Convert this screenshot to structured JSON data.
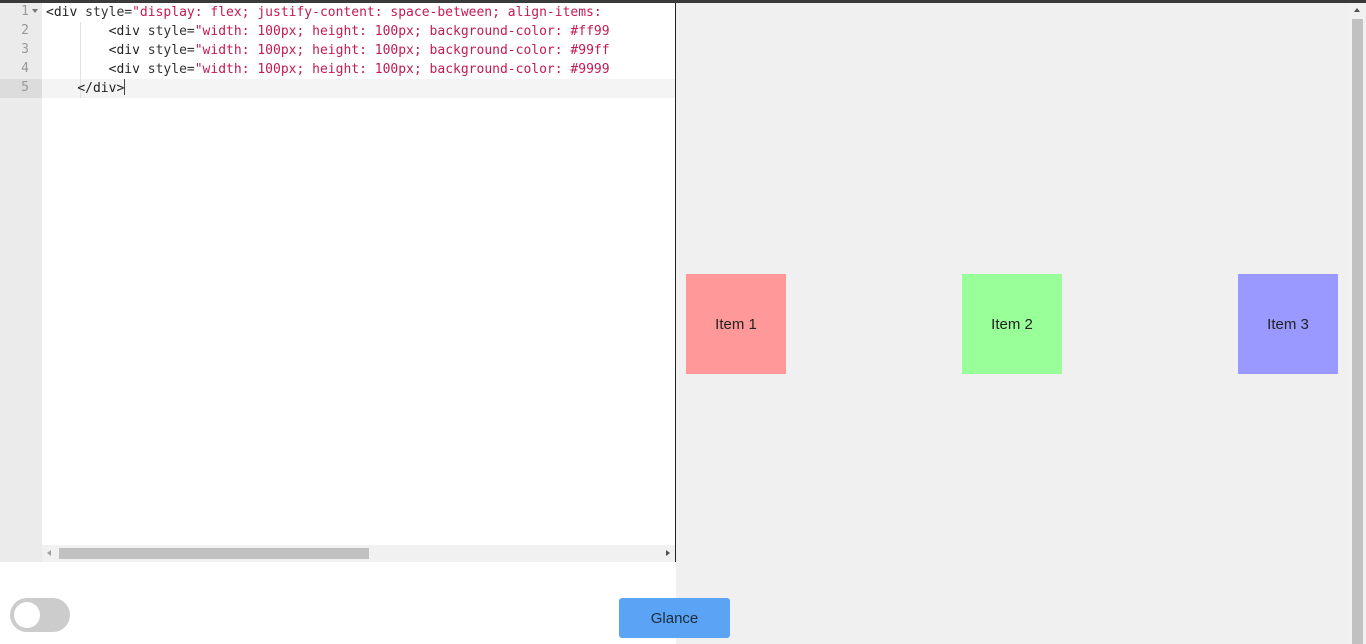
{
  "editor": {
    "line_numbers": [
      "1",
      "2",
      "3",
      "4",
      "5"
    ],
    "lines": [
      {
        "indent": "",
        "tag": "<div ",
        "attr": "style=",
        "value": "\"display: flex; justify-content: space-between; align-items:",
        "close": ""
      },
      {
        "indent": "        ",
        "tag": "<div ",
        "attr": "style=",
        "value": "\"width: 100px; height: 100px; background-color: #ff99",
        "close": ""
      },
      {
        "indent": "        ",
        "tag": "<div ",
        "attr": "style=",
        "value": "\"width: 100px; height: 100px; background-color: #99ff",
        "close": ""
      },
      {
        "indent": "        ",
        "tag": "<div ",
        "attr": "style=",
        "value": "\"width: 100px; height: 100px; background-color: #9999",
        "close": ""
      },
      {
        "indent": "    ",
        "tag": "</div>",
        "attr": "",
        "value": "",
        "close": ""
      }
    ]
  },
  "preview": {
    "items": [
      {
        "label": "Item 1",
        "color": "#ff9999"
      },
      {
        "label": "Item 2",
        "color": "#99ff99"
      },
      {
        "label": "Item 3",
        "color": "#9999ff"
      }
    ]
  },
  "toolbar": {
    "glance_label": "Glance",
    "toggle_on": false,
    "button_color": "#5ba3f5"
  }
}
